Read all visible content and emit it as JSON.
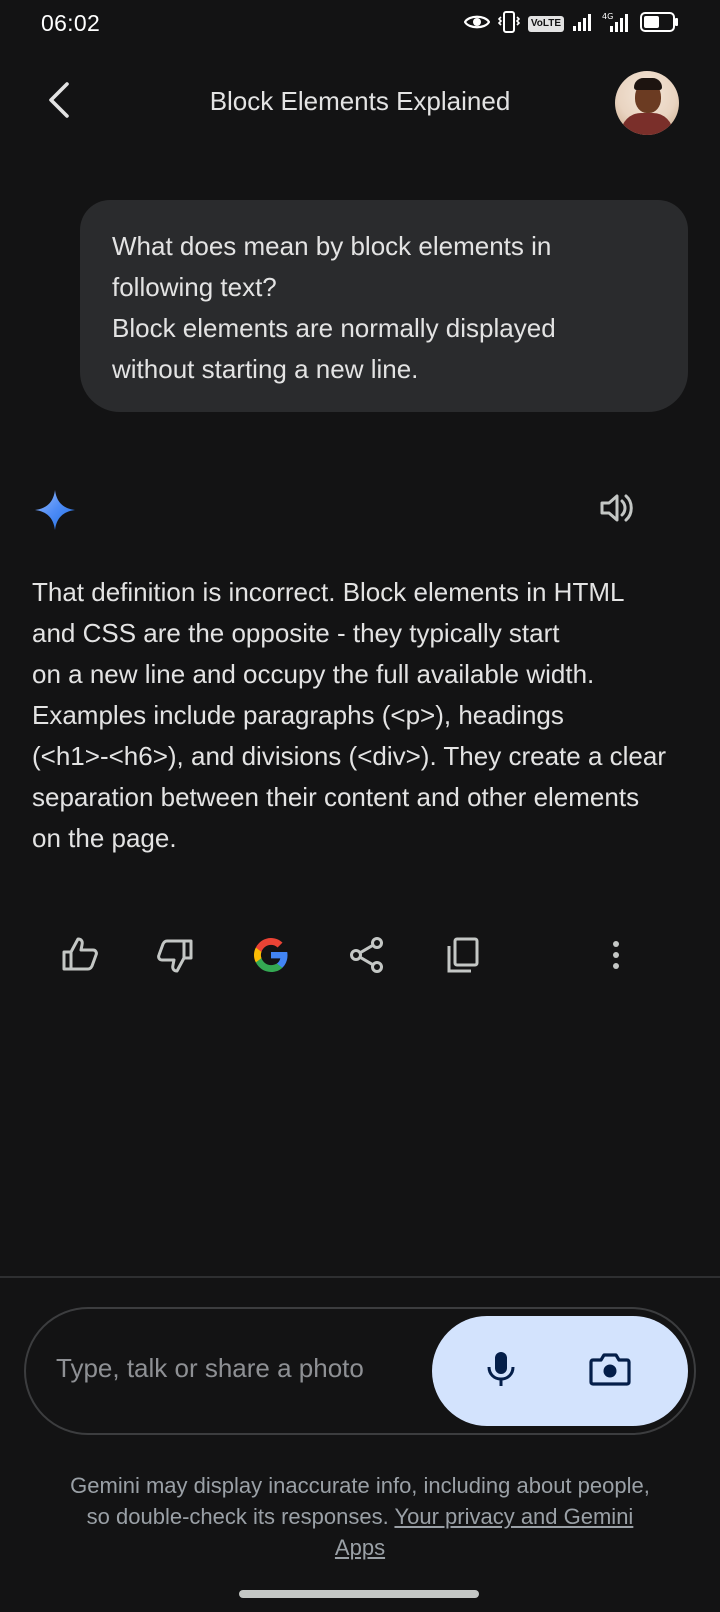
{
  "status_bar": {
    "time": "06:02",
    "volte": "VoLTE",
    "icons": [
      "eye-icon",
      "vibrate-icon",
      "volte-badge",
      "signal-icon",
      "4g-signal-icon",
      "battery-icon"
    ]
  },
  "header": {
    "title": "Block Elements Explained",
    "back_icon": "chevron-left-icon",
    "avatar": "user-avatar"
  },
  "user_message": {
    "lines": [
      "What does mean by block elements in",
      "following text?",
      "Block elements are normally displayed",
      "without starting a new line."
    ]
  },
  "response": {
    "logo_icon": "gemini-sparkle-icon",
    "speaker_icon": "speaker-icon",
    "lines": [
      "That definition is incorrect. Block elements in HTML",
      "and CSS are the opposite - they typically start",
      "on a new line and occupy the full available width.",
      "Examples include paragraphs (<p>), headings",
      "(<h1>-<h6>), and divisions (<div>). They create a clear",
      "separation between their content and other elements",
      "on the page."
    ]
  },
  "actions": {
    "icons": [
      "thumbs-up-icon",
      "thumbs-down-icon",
      "google-icon",
      "share-icon",
      "copy-icon",
      "more-vert-icon"
    ]
  },
  "input": {
    "placeholder": "Type, talk or share a photo",
    "mic_icon": "mic-icon",
    "camera_icon": "camera-icon"
  },
  "disclaimer": {
    "line1": "Gemini may display inaccurate info, including about people,",
    "line2_text": "so double-check its responses.",
    "link_text": "Your privacy and Gemini",
    "line3_link": "Apps"
  },
  "colors": {
    "background": "#131314",
    "bubble": "#2a2b2d",
    "pill": "#d3e3fd",
    "pill_icon": "#041e49",
    "sparkle_start": "#4e8cf6",
    "sparkle_end": "#1e6de0"
  }
}
